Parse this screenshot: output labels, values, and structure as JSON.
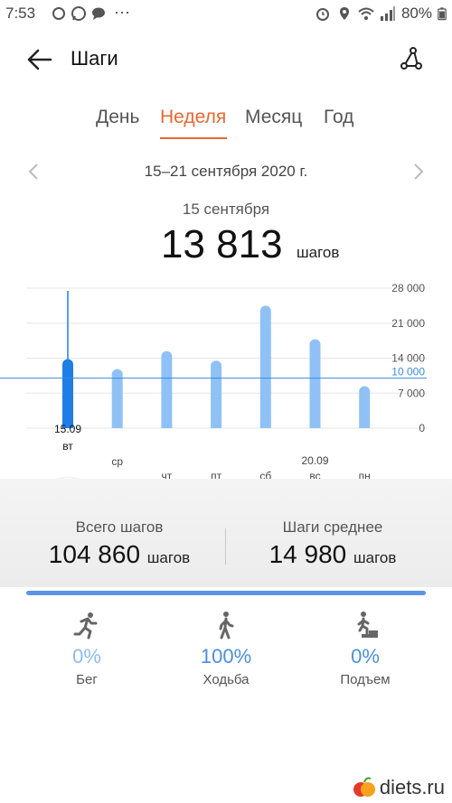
{
  "status": {
    "time": "7:53",
    "dots": "···",
    "battery": "80%"
  },
  "appbar": {
    "title": "Шаги"
  },
  "tabs": [
    {
      "label": "День",
      "active": false
    },
    {
      "label": "Неделя",
      "active": true
    },
    {
      "label": "Месяц",
      "active": false
    },
    {
      "label": "Год",
      "active": false
    }
  ],
  "period": {
    "label": "15–21 сентября 2020 г."
  },
  "selected": {
    "date": "15 сентября",
    "value": "13 813",
    "unit": "шагов"
  },
  "chart_data": {
    "type": "bar",
    "categories": [
      "вт",
      "ср",
      "чт",
      "пт",
      "сб",
      "вс",
      "пн"
    ],
    "date_labels": {
      "0": "15.09",
      "5": "20.09"
    },
    "values": [
      13813,
      11800,
      15400,
      13500,
      24500,
      17800,
      8400
    ],
    "selected_index": 0,
    "goal": 10000,
    "goal_label": "10 000",
    "ylim": [
      0,
      28000
    ],
    "yticks": [
      {
        "value": 28000,
        "label": "28 000"
      },
      {
        "value": 21000,
        "label": "21 000"
      },
      {
        "value": 14000,
        "label": "14 000"
      },
      {
        "value": 7000,
        "label": "7 000"
      },
      {
        "value": 0,
        "label": "0"
      }
    ],
    "colors": {
      "bar": "#8fc1f7",
      "selected": "#1f7de6",
      "goal": "#3b8be0",
      "grid": "#e6e6e6"
    }
  },
  "stats": {
    "total": {
      "label": "Всего шагов",
      "value": "104 860",
      "unit": "шагов"
    },
    "average": {
      "label": "Шаги среднее",
      "value": "14 980",
      "unit": "шагов"
    }
  },
  "activities": [
    {
      "icon": "running-icon",
      "percent": "0%",
      "label": "Бег",
      "color": "#8cbcf2"
    },
    {
      "icon": "walking-icon",
      "percent": "100%",
      "label": "Ходьба",
      "color": "#4a8fe0"
    },
    {
      "icon": "climbing-icon",
      "percent": "0%",
      "label": "Подъем",
      "color": "#4a8fe0"
    }
  ],
  "brand": {
    "text": "diets.ru"
  }
}
